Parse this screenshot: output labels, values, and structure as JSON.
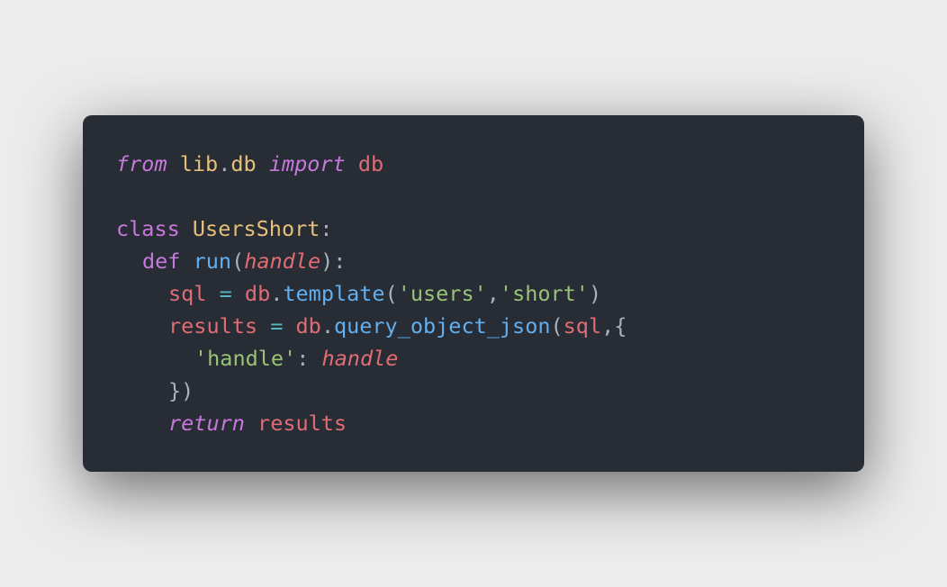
{
  "code": {
    "line1": {
      "from": "from",
      "module": "lib",
      "dot": ".",
      "submodule": "db",
      "import": "import",
      "name": "db"
    },
    "line3": {
      "class_kw": "class",
      "class_name": "UsersShort",
      "colon": ":"
    },
    "line4": {
      "def_kw": "def",
      "fn_name": "run",
      "open": "(",
      "param": "handle",
      "close": "):"
    },
    "line5": {
      "var": "sql",
      "eq": "=",
      "obj": "db",
      "dot": ".",
      "method": "template",
      "open": "(",
      "arg1": "'users'",
      "comma": ",",
      "arg2": "'short'",
      "close": ")"
    },
    "line6": {
      "var": "results",
      "eq": "=",
      "obj": "db",
      "dot": ".",
      "method": "query_object_json",
      "open": "(",
      "arg": "sql",
      "rest": ",{"
    },
    "line7": {
      "key": "'handle'",
      "colon": ":",
      "value": "handle"
    },
    "line8": {
      "close": "})"
    },
    "line9": {
      "return_kw": "return",
      "value": "results"
    }
  },
  "theme": {
    "background": "#ececec",
    "card": "#282c34",
    "keyword": "#c678dd",
    "class_name": "#e5c07b",
    "variable": "#e06c75",
    "function": "#61afef",
    "string": "#98c379",
    "operator": "#56b6c2",
    "text": "#abb2bf"
  }
}
